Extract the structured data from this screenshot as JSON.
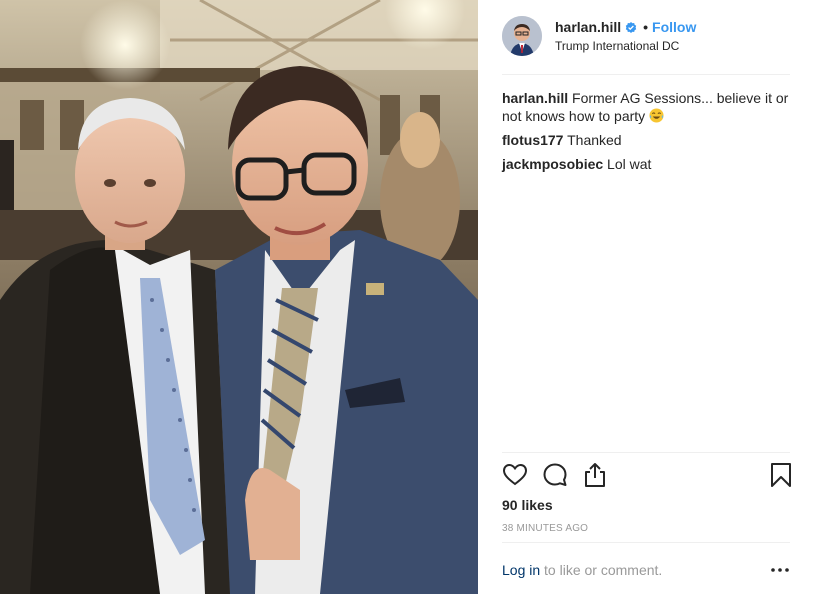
{
  "post": {
    "image_alt": "Photo of two men in suits posing in a hotel lobby",
    "colors": {
      "link": "#3897f0",
      "login_link": "#003569",
      "muted": "#999999",
      "text": "#262626",
      "divider": "#efefef"
    }
  },
  "header": {
    "username": "harlan.hill",
    "separator": "•",
    "follow_label": "Follow",
    "location": "Trump International DC",
    "verified_icon": "verified-badge-icon"
  },
  "comments": [
    {
      "username": "harlan.hill",
      "text": "Former AG Sessions... believe it or not knows how to party",
      "emoji": "laughing-tears-emoji"
    },
    {
      "username": "flotus177",
      "text": "Thanked"
    },
    {
      "username": "jackmposobiec",
      "text": "Lol wat"
    }
  ],
  "actions": {
    "like_icon": "heart-icon",
    "comment_icon": "comment-icon",
    "share_icon": "share-icon",
    "save_icon": "bookmark-icon"
  },
  "stats": {
    "likes": "90 likes",
    "time_ago": "38 MINUTES AGO"
  },
  "footer": {
    "login_label": "Log in",
    "login_suffix": " to like or comment.",
    "more_icon": "more-options-icon"
  }
}
